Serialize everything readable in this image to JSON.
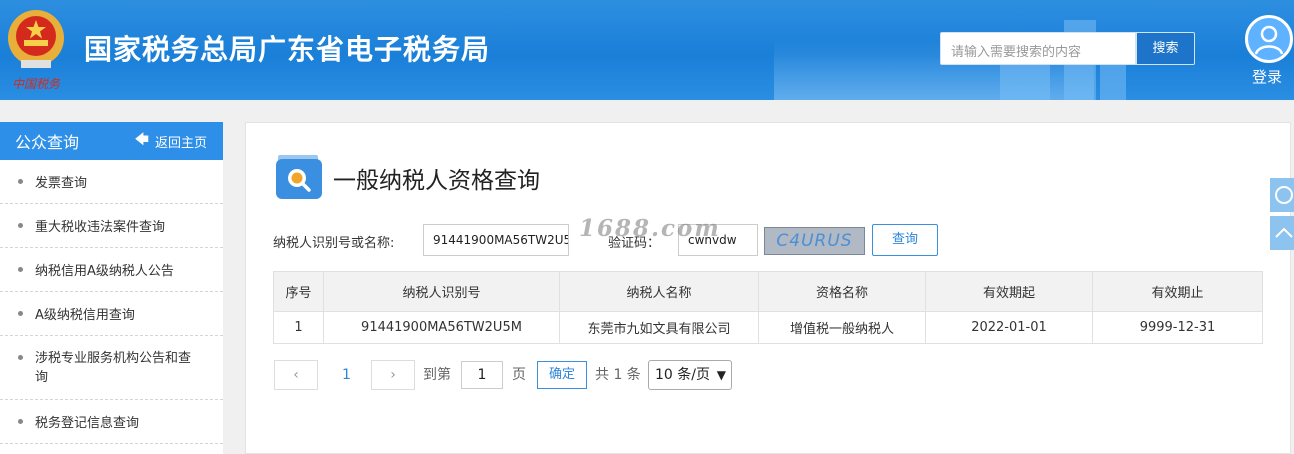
{
  "header": {
    "site_title": "国家税务总局广东省电子税务局",
    "emblem_caption": "中国税务",
    "search_placeholder": "请输入需要搜索的内容",
    "search_button": "搜索",
    "login_label": "登录"
  },
  "sidebar": {
    "title": "公众查询",
    "back_home": "返回主页",
    "items": [
      {
        "label": "发票查询"
      },
      {
        "label": "重大税收违法案件查询"
      },
      {
        "label": "纳税信用A级纳税人公告"
      },
      {
        "label": "A级纳税信用查询"
      },
      {
        "label": "涉税专业服务机构公告和查询"
      },
      {
        "label": "税务登记信息查询"
      }
    ]
  },
  "main": {
    "page_title": "一般纳税人资格查询",
    "form": {
      "taxpayer_label": "纳税人识别号或名称:",
      "taxpayer_value": "91441900MA56TW2U5",
      "captcha_label": "验证码：",
      "captcha_value": "cwnvdw",
      "captcha_image_text": "C4URUS",
      "query_button": "查询"
    },
    "watermark": "1688.com",
    "table": {
      "headers": [
        "序号",
        "纳税人识别号",
        "纳税人名称",
        "资格名称",
        "有效期起",
        "有效期止"
      ],
      "rows": [
        [
          "1",
          "91441900MA56TW2U5M",
          "东莞市九如文具有限公司",
          "增值税一般纳税人",
          "2022-01-01",
          "9999-12-31"
        ]
      ]
    },
    "pagination": {
      "prev_icon": "chevron-left-icon",
      "current_page": "1",
      "next_icon": "chevron-right-icon",
      "goto_label": "到第",
      "goto_value": "1",
      "page_unit": "页",
      "confirm": "确定",
      "total": "共 1 条",
      "page_size": "10 条/页"
    }
  },
  "colors": {
    "header_blue": "#1a7fd8",
    "sidebar_head": "#2d8fe8",
    "link_blue": "#2d86da"
  }
}
